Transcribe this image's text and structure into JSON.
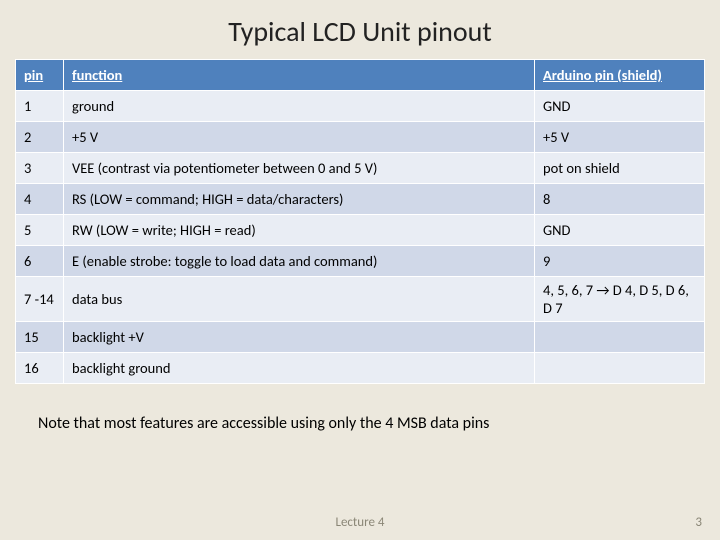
{
  "title": "Typical LCD Unit pinout",
  "headers": {
    "pin": "pin",
    "function": "function",
    "arduino": "Arduino pin (shield)"
  },
  "rows": [
    {
      "pin": "1",
      "function": "ground",
      "arduino": "GND"
    },
    {
      "pin": "2",
      "function": "+5 V",
      "arduino": "+5 V"
    },
    {
      "pin": "3",
      "function": "VEE (contrast via potentiometer between 0 and 5 V)",
      "arduino": "pot on shield"
    },
    {
      "pin": "4",
      "function": "RS (LOW = command; HIGH = data/characters)",
      "arduino": "8"
    },
    {
      "pin": "5",
      "function": "RW (LOW = write; HIGH = read)",
      "arduino": "GND"
    },
    {
      "pin": "6",
      "function": "E (enable strobe: toggle to load data and command)",
      "arduino": "9"
    },
    {
      "pin": "7 -14",
      "function": "data bus",
      "arduino": "4, 5, 6, 7 → D 4, D 5, D 6, D 7"
    },
    {
      "pin": "15",
      "function": "backlight +V",
      "arduino": ""
    },
    {
      "pin": "16",
      "function": "backlight ground",
      "arduino": ""
    }
  ],
  "note": "Note that most features are accessible using only the 4 MSB data pins",
  "footer": {
    "center": "Lecture 4",
    "page": "3"
  }
}
